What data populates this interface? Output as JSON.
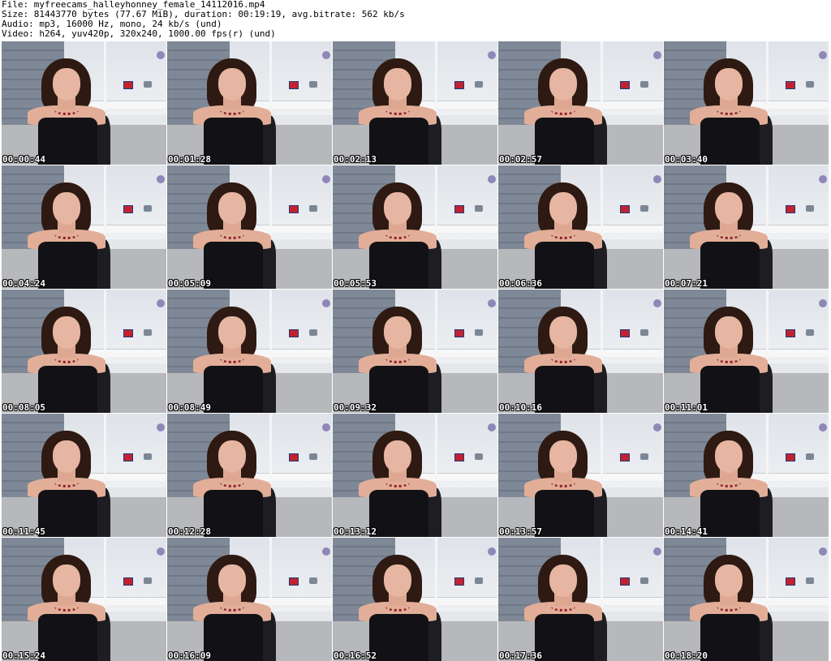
{
  "header": {
    "file_line": "File: myfreecams_halleyhonney_female_14112016.mp4",
    "size_line": "Size: 81443770 bytes (77.67 MiB), duration: 00:19:19, avg.bitrate: 562 kb/s",
    "audio_line": "Audio: mp3, 16000 Hz, mono, 24 kb/s (und)",
    "video_line": "Video: h264, yuv420p, 320x240, 1000.00 fps(r) (und)"
  },
  "thumbnails": [
    {
      "timestamp": "00:00:44"
    },
    {
      "timestamp": "00:01:28"
    },
    {
      "timestamp": "00:02:13"
    },
    {
      "timestamp": "00:02:57"
    },
    {
      "timestamp": "00:03:40"
    },
    {
      "timestamp": "00:04:24"
    },
    {
      "timestamp": "00:05:09"
    },
    {
      "timestamp": "00:05:53"
    },
    {
      "timestamp": "00:06:36"
    },
    {
      "timestamp": "00:07:21"
    },
    {
      "timestamp": "00:08:05"
    },
    {
      "timestamp": "00:08:49"
    },
    {
      "timestamp": "00:09:32"
    },
    {
      "timestamp": "00:10:16"
    },
    {
      "timestamp": "00:11:01"
    },
    {
      "timestamp": "00:11:45"
    },
    {
      "timestamp": "00:12:28"
    },
    {
      "timestamp": "00:13:12"
    },
    {
      "timestamp": "00:13:57"
    },
    {
      "timestamp": "00:14:41"
    },
    {
      "timestamp": "00:15:24"
    },
    {
      "timestamp": "00:16:09"
    },
    {
      "timestamp": "00:16:52"
    },
    {
      "timestamp": "00:17:36"
    },
    {
      "timestamp": "00:18:20"
    }
  ]
}
